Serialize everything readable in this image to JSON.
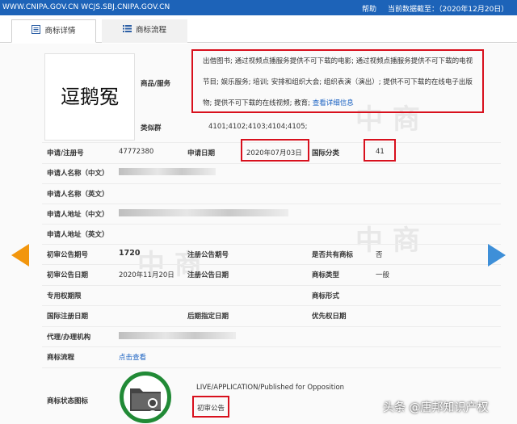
{
  "topbar": {
    "site": "WWW.CNIPA.GOV.CN WCJS.SBJ.CNIPA.GOV.CN",
    "help": "帮助",
    "date": "当前数据截至：（2020年12月20日）"
  },
  "tabs": [
    {
      "label": "商标详情"
    },
    {
      "label": "商标流程"
    }
  ],
  "mark": {
    "text": "逗鹅冤"
  },
  "labels": {
    "goods": "商品/服务",
    "similar": "类似群",
    "reg_no": "申请/注册号",
    "app_date": "申请日期",
    "intl_class": "国际分类",
    "applicant_cn": "申请人名称（中文）",
    "applicant_en": "申请人名称（英文）",
    "address_cn": "申请人地址（中文）",
    "address_en": "申请人地址（英文）",
    "prelim_no": "初审公告期号",
    "reg_pub_no": "注册公告期号",
    "shared": "是否共有商标",
    "prelim_date": "初审公告日期",
    "reg_pub_date": "注册公告日期",
    "mark_type": "商标类型",
    "excl_period": "专用权期限",
    "mark_form": "商标形式",
    "intl_reg_date": "国际注册日期",
    "later_date": "后期指定日期",
    "priority_date": "优先权日期",
    "agent": "代理/办理机构",
    "flow": "商标流程",
    "status_icon": "商标状态图标"
  },
  "values": {
    "goods": "出借图书; 通过视频点播服务提供不可下载的电影; 通过视频点播服务提供不可下载的电视节目; 娱乐服务; 培训; 安排和组织大会; 组织表演（演出）; 提供不可下载的在线电子出版物; 提供不可下载的在线视频; 教育;",
    "goods_more": "查看详细信息",
    "similar": "4101;4102;4103;4104;4105;",
    "reg_no": "47772380",
    "app_date": "2020年07月03日",
    "intl_class": "41",
    "prelim_no": "1720",
    "shared": "否",
    "prelim_date": "2020年11月20日",
    "mark_type": "一般",
    "flow_link": "点击查看",
    "status_en": "LIVE/APPLICATION/Published for Opposition",
    "status_cn": "初审公告"
  },
  "nav": {
    "prev": "previous-record",
    "next": "next-record"
  },
  "footer_watermark": "头条 @唐邦知识产权",
  "colors": {
    "topbar": "#1d63b8",
    "highlight": "#d8101d",
    "link": "#1b62c2",
    "status_ring": "#218a36",
    "prev_arrow": "#f2960d",
    "next_arrow": "#3e8fd8"
  }
}
